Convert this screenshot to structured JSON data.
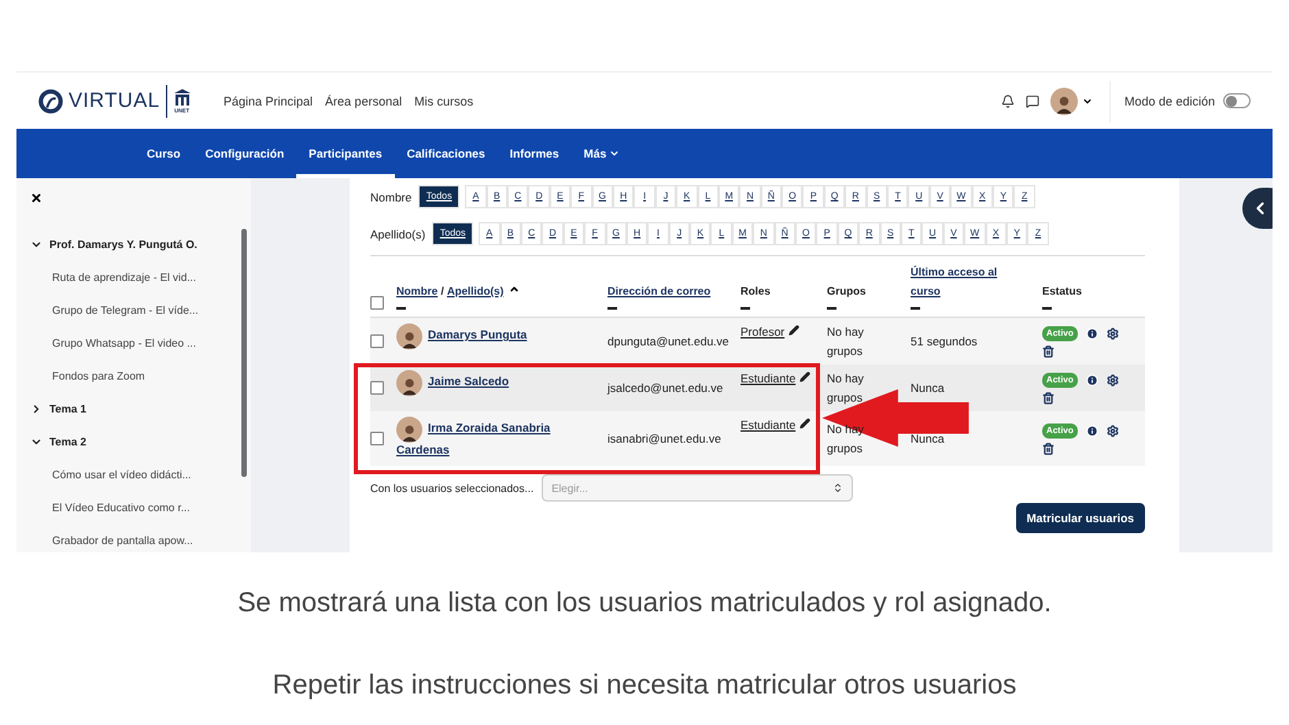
{
  "header": {
    "logo": "VIRTUAL",
    "logo_sub": "UNET",
    "links": [
      "Página Principal",
      "Área personal",
      "Mis cursos"
    ],
    "edit_mode": {
      "label": "Modo de edición",
      "on": false
    }
  },
  "course_nav": [
    {
      "label": "Curso",
      "selected": false,
      "menu": false
    },
    {
      "label": "Configuración",
      "selected": false,
      "menu": false
    },
    {
      "label": "Participantes",
      "selected": true,
      "menu": false
    },
    {
      "label": "Calificaciones",
      "selected": false,
      "menu": false
    },
    {
      "label": "Informes",
      "selected": false,
      "menu": false
    },
    {
      "label": "Más",
      "selected": false,
      "menu": true
    }
  ],
  "sidebar": {
    "items": [
      {
        "label": "Prof. Damarys Y. Pungutá O.",
        "expanded": true,
        "children": [
          {
            "label": "Ruta de aprendizaje - El vid..."
          },
          {
            "label": "Grupo de Telegram - El víde..."
          },
          {
            "label": "Grupo Whatsapp - El video ..."
          },
          {
            "label": "Fondos para Zoom"
          }
        ]
      },
      {
        "label": "Tema 1",
        "expanded": false
      },
      {
        "label": "Tema 2",
        "expanded": true,
        "children": [
          {
            "label": "Cómo usar el vídeo didácti..."
          },
          {
            "label": "El Vídeo Educativo como r..."
          },
          {
            "label": "Grabador de pantalla apow..."
          }
        ]
      }
    ]
  },
  "filters": [
    {
      "label": "Nombre",
      "letters": [
        {
          "label": "Todos",
          "selected": true
        },
        {
          "label": "A",
          "selected": false
        },
        {
          "label": "B",
          "selected": false
        },
        {
          "label": "C",
          "selected": false
        },
        {
          "label": "D",
          "selected": false
        },
        {
          "label": "E",
          "selected": false
        },
        {
          "label": "F",
          "selected": false
        },
        {
          "label": "G",
          "selected": false
        },
        {
          "label": "H",
          "selected": false
        },
        {
          "label": "I",
          "selected": false
        },
        {
          "label": "J",
          "selected": false
        },
        {
          "label": "K",
          "selected": false
        },
        {
          "label": "L",
          "selected": false
        },
        {
          "label": "M",
          "selected": false
        },
        {
          "label": "N",
          "selected": false
        },
        {
          "label": "Ñ",
          "selected": false
        },
        {
          "label": "O",
          "selected": false
        },
        {
          "label": "P",
          "selected": false
        },
        {
          "label": "Q",
          "selected": false
        },
        {
          "label": "R",
          "selected": false
        },
        {
          "label": "S",
          "selected": false
        },
        {
          "label": "T",
          "selected": false
        },
        {
          "label": "U",
          "selected": false
        },
        {
          "label": "V",
          "selected": false
        },
        {
          "label": "W",
          "selected": false
        },
        {
          "label": "X",
          "selected": false
        },
        {
          "label": "Y",
          "selected": false
        },
        {
          "label": "Z",
          "selected": false
        }
      ]
    },
    {
      "label": "Apellido(s)",
      "letters": [
        {
          "label": "Todos",
          "selected": true
        },
        {
          "label": "A",
          "selected": false
        },
        {
          "label": "B",
          "selected": false
        },
        {
          "label": "C",
          "selected": false
        },
        {
          "label": "D",
          "selected": false
        },
        {
          "label": "E",
          "selected": false
        },
        {
          "label": "F",
          "selected": false
        },
        {
          "label": "G",
          "selected": false
        },
        {
          "label": "H",
          "selected": false
        },
        {
          "label": "I",
          "selected": false
        },
        {
          "label": "J",
          "selected": false
        },
        {
          "label": "K",
          "selected": false
        },
        {
          "label": "L",
          "selected": false
        },
        {
          "label": "M",
          "selected": false
        },
        {
          "label": "N",
          "selected": false
        },
        {
          "label": "Ñ",
          "selected": false
        },
        {
          "label": "O",
          "selected": false
        },
        {
          "label": "P",
          "selected": false
        },
        {
          "label": "Q",
          "selected": false
        },
        {
          "label": "R",
          "selected": false
        },
        {
          "label": "S",
          "selected": false
        },
        {
          "label": "T",
          "selected": false
        },
        {
          "label": "U",
          "selected": false
        },
        {
          "label": "V",
          "selected": false
        },
        {
          "label": "W",
          "selected": false
        },
        {
          "label": "X",
          "selected": false
        },
        {
          "label": "Y",
          "selected": false
        },
        {
          "label": "Z",
          "selected": false
        }
      ]
    }
  ],
  "table": {
    "select_all": {
      "checked": false
    },
    "columns": [
      {
        "links": [
          "Nombre",
          "Apellido(s)"
        ],
        "separator": "/",
        "sorted": true
      },
      {
        "links": [
          "Dirección de correo"
        ]
      },
      {
        "label": "Roles"
      },
      {
        "label": "Grupos"
      },
      {
        "links": [
          "Último acceso al curso"
        ]
      },
      {
        "label": "Estatus"
      }
    ],
    "rows": [
      {
        "checked": false,
        "name": "Damarys Punguta",
        "email": "dpunguta@unet.edu.ve",
        "role": "Profesor",
        "groups": "No hay grupos",
        "last_access": "51 segundos",
        "status": "Activo"
      },
      {
        "checked": false,
        "name": "Jaime Salcedo",
        "email": "jsalcedo@unet.edu.ve",
        "role": "Estudiante",
        "groups": "No hay grupos",
        "last_access": "Nunca",
        "status": "Activo"
      },
      {
        "checked": false,
        "name": "Irma Zoraida Sanabria Cardenas",
        "email": "isanabri@unet.edu.ve",
        "role": "Estudiante",
        "groups": "No hay grupos",
        "last_access": "Nunca",
        "status": "Activo"
      }
    ]
  },
  "bulk": {
    "label": "Con los usuarios seleccionados...",
    "placeholder": "Elegir...",
    "button": "Matricular usuarios"
  },
  "caption": [
    "Se mostrará una lista con los usuarios matriculados y rol asignado.",
    "Repetir las instrucciones si necesita matricular otros usuarios"
  ]
}
